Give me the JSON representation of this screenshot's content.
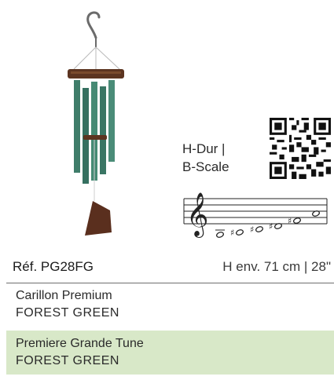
{
  "product": {
    "image_name": "wind-chime-image",
    "scale_label_line1": "H-Dur |",
    "scale_label_line2": "B-Scale",
    "ref": "Réf. PG28FG",
    "size": "H env. 71 cm | 28\""
  },
  "block1": {
    "title": "Carillon Premium",
    "subtitle": "FOREST GREEN"
  },
  "block2": {
    "title": "Premiere Grande Tune",
    "subtitle": "FOREST GREEN"
  },
  "colors": {
    "tube_green": "#3f7d6a",
    "wood_brown": "#5c3420",
    "highlight_green": "#d8e8c8"
  }
}
